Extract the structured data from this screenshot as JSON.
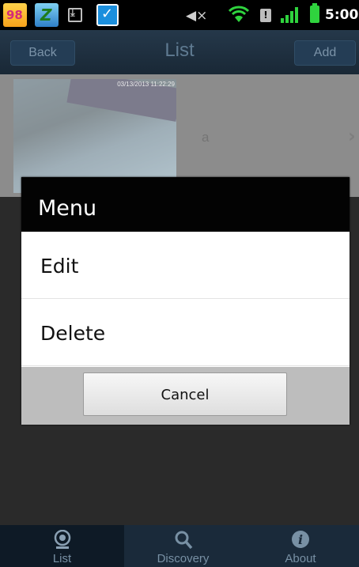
{
  "status_bar": {
    "time": "5:00",
    "app1_glyph": "98",
    "app2_glyph": "Z",
    "app3_glyph": "✓",
    "alert_glyph": "!",
    "icons": [
      "game-app-icon",
      "zip-app-icon",
      "download-icon",
      "check-app-icon",
      "mute-icon",
      "wifi-icon",
      "alert-icon",
      "signal-icon",
      "battery-icon"
    ]
  },
  "title_bar": {
    "back_label": "Back",
    "title": "List",
    "add_label": "Add"
  },
  "list": {
    "items": [
      {
        "thumbnail_timestamp": "03/13/2013 11:22:29",
        "label": "a"
      }
    ]
  },
  "dialog": {
    "title": "Menu",
    "items": [
      {
        "label": "Edit"
      },
      {
        "label": "Delete"
      }
    ],
    "cancel_label": "Cancel"
  },
  "tabs": [
    {
      "label": "List",
      "icon": "webcam-icon",
      "active": true
    },
    {
      "label": "Discovery",
      "icon": "search-icon",
      "active": false
    },
    {
      "label": "About",
      "icon": "info-icon",
      "active": false
    }
  ],
  "colors": {
    "title_bar": "#1f3143",
    "tab_bar": "#1a2a3a",
    "dialog_header": "#030303"
  }
}
